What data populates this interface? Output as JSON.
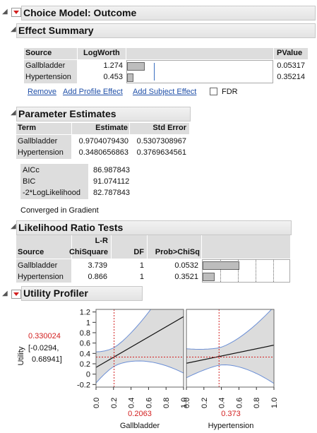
{
  "report": {
    "title": "Choice Model: Outcome"
  },
  "effect_summary": {
    "title": "Effect Summary",
    "columns": [
      "Source",
      "LogWorth",
      "PValue"
    ],
    "rows": [
      {
        "source": "Gallbladder",
        "logworth": "1.274",
        "pvalue": "0.05317",
        "bar_fraction": 0.12
      },
      {
        "source": "Hypertension",
        "logworth": "0.453",
        "pvalue": "0.35214",
        "bar_fraction": 0.045
      }
    ],
    "links": [
      "Remove",
      "Add Profile Effect",
      "Add Subject Effect"
    ],
    "fdr_label": "FDR"
  },
  "parameter_estimates": {
    "title": "Parameter Estimates",
    "columns": [
      "Term",
      "Estimate",
      "Std Error"
    ],
    "rows": [
      {
        "term": "Gallbladder",
        "estimate": "0.9704079430",
        "std_error": "0.5307308967"
      },
      {
        "term": "Hypertension",
        "estimate": "0.3480656863",
        "std_error": "0.3769634561"
      }
    ],
    "fit": [
      {
        "label": "AICc",
        "value": "86.987843"
      },
      {
        "label": "BIC",
        "value": "91.074112"
      },
      {
        "label": "-2*LogLikelihood",
        "value": "82.787843"
      }
    ],
    "status": "Converged in Gradient"
  },
  "lr_tests": {
    "title": "Likelihood Ratio Tests",
    "columns": [
      "Source",
      "L-R",
      "ChiSquare",
      "DF",
      "Prob>ChiSq"
    ],
    "rows": [
      {
        "source": "Gallbladder",
        "chisq": "3.739",
        "df": "1",
        "prob": "0.0532",
        "bar_fraction": 0.55
      },
      {
        "source": "Hypertension",
        "chisq": "0.866",
        "df": "1",
        "prob": "0.3521",
        "bar_fraction": 0.17
      }
    ]
  },
  "profiler": {
    "title": "Utility Profiler",
    "ylabel": "Utility",
    "current_value": "0.330024",
    "ci_low": "[-0.0294,",
    "ci_high": "0.68941]",
    "y_ticks": [
      "1.2",
      "1",
      "0.8",
      "0.6",
      "0.4",
      "0.2",
      "0",
      "-0.2"
    ],
    "x_ticks": [
      "0.0",
      "0.2",
      "0.4",
      "0.6",
      "0.8",
      "1.0"
    ],
    "panels": [
      {
        "name": "Gallbladder",
        "current": "0.2063"
      },
      {
        "name": "Hypertension",
        "current": "0.373"
      }
    ],
    "colors": {
      "accent": "#d32020",
      "band": "#dcdcdc",
      "ci_line": "#6b8fd6"
    }
  },
  "chart_data": {
    "type": "line",
    "ylabel": "Utility",
    "ylim": [
      -0.25,
      1.25
    ],
    "series": [
      {
        "name": "Gallbladder",
        "x": [
          0,
          1
        ],
        "y": [
          0.13,
          1.11
        ],
        "lower": [
          -0.17,
          0.05
        ],
        "upper": [
          0.43,
          2.2
        ],
        "current_x": 0.2063
      },
      {
        "name": "Hypertension",
        "x": [
          0,
          1
        ],
        "y": [
          0.21,
          0.56
        ],
        "lower": [
          -0.07,
          -0.18
        ],
        "upper": [
          0.49,
          1.3
        ],
        "current_x": 0.373
      }
    ],
    "current_y": 0.330024
  }
}
